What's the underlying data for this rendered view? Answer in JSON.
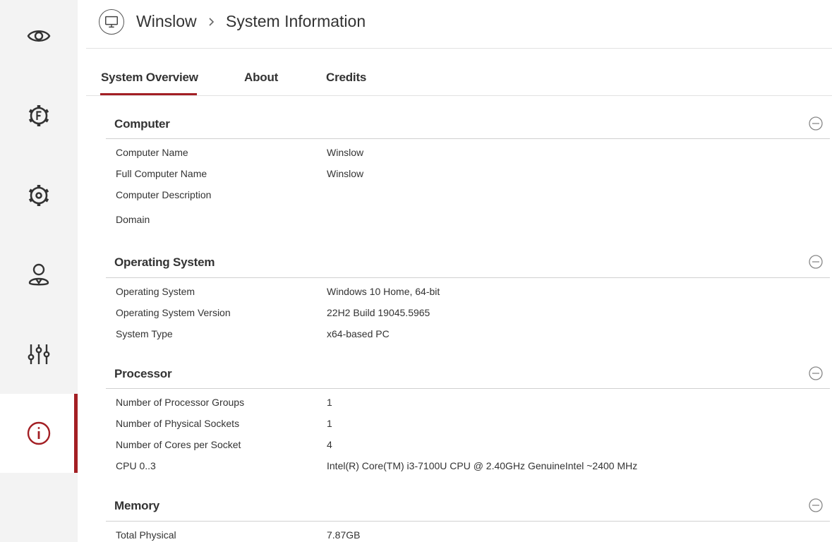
{
  "sidebar": {
    "items": [
      {
        "name": "eye-icon"
      },
      {
        "name": "gear-f-icon"
      },
      {
        "name": "gear-icon"
      },
      {
        "name": "user-icon"
      },
      {
        "name": "sliders-icon"
      },
      {
        "name": "info-icon",
        "active": true
      }
    ]
  },
  "colors": {
    "accent": "#a31f24",
    "sidebar_bg": "#f3f3f3"
  },
  "header": {
    "icon": "monitor-icon",
    "breadcrumb": [
      "Winslow",
      "System Information"
    ]
  },
  "tabs": [
    {
      "label": "System Overview",
      "active": true
    },
    {
      "label": "About"
    },
    {
      "label": "Credits"
    }
  ],
  "sections": {
    "computer": {
      "title": "Computer",
      "rows": [
        {
          "label": "Computer Name",
          "value": "Winslow"
        },
        {
          "label": "Full Computer Name",
          "value": "Winslow"
        },
        {
          "label": "Computer Description",
          "value": ""
        },
        {
          "label": "Domain",
          "value": ""
        }
      ]
    },
    "os": {
      "title": "Operating System",
      "rows": [
        {
          "label": "Operating System",
          "value": "Windows 10 Home, 64-bit"
        },
        {
          "label": "Operating System Version",
          "value": "22H2 Build 19045.5965"
        },
        {
          "label": "System Type",
          "value": "x64-based PC"
        }
      ]
    },
    "processor": {
      "title": "Processor",
      "rows": [
        {
          "label": "Number of Processor Groups",
          "value": "1"
        },
        {
          "label": "Number of Physical Sockets",
          "value": "1"
        },
        {
          "label": "Number of Cores per Socket",
          "value": "4"
        },
        {
          "label": "CPU 0..3",
          "value": "Intel(R) Core(TM) i3-7100U CPU @ 2.40GHz GenuineIntel ~2400 MHz"
        }
      ]
    },
    "memory": {
      "title": "Memory",
      "rows": [
        {
          "label": "Total Physical",
          "value": "7.87GB"
        }
      ]
    }
  }
}
